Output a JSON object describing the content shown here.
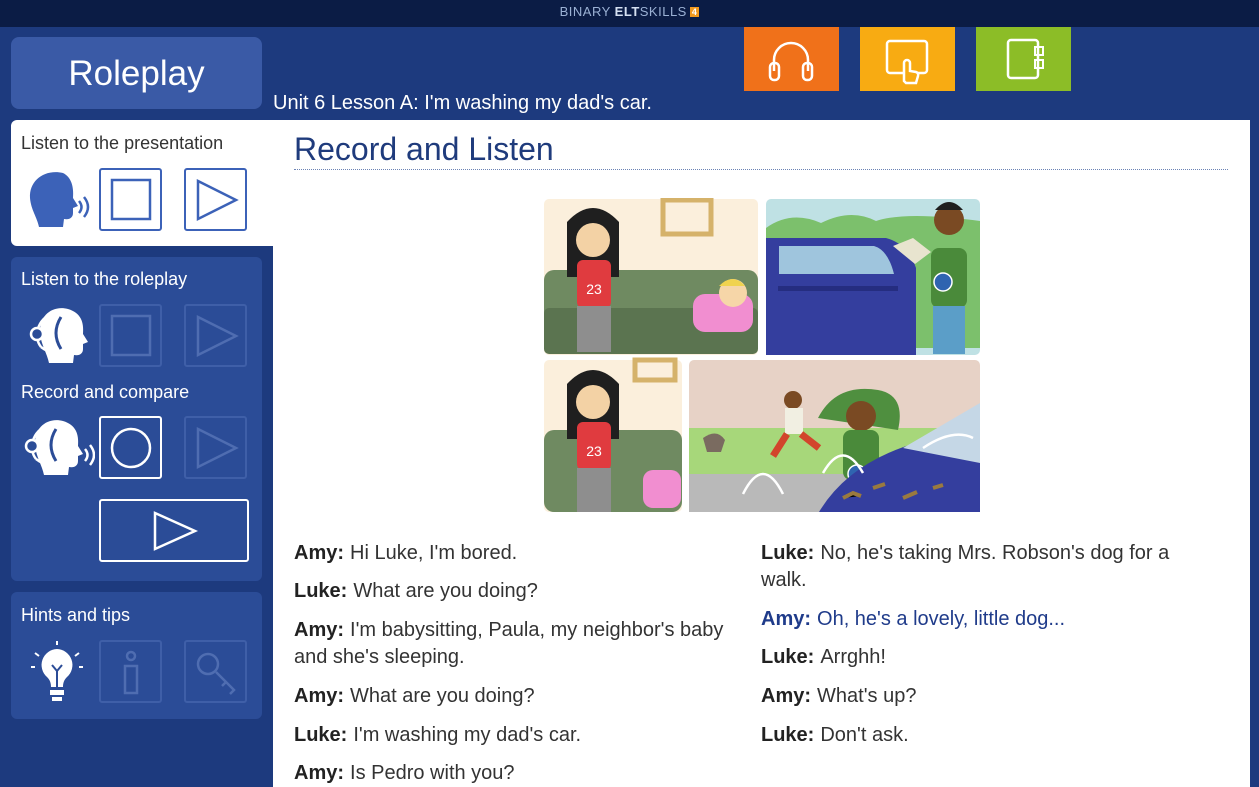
{
  "brand": {
    "part1": "BINARY ",
    "part2": "ELT",
    "part3": "SKILLS",
    "badge": "4"
  },
  "sidebar": {
    "title": "Roleplay",
    "sections": [
      {
        "label": "Listen to the presentation"
      },
      {
        "label": "Listen to the roleplay"
      },
      {
        "label": "Record and compare"
      },
      {
        "label": "Hints and tips"
      }
    ]
  },
  "lesson_title": "Unit 6 Lesson A: I'm washing my dad's car.",
  "top_buttons": [
    {
      "icon": "headphones-icon",
      "color": "#f0711a"
    },
    {
      "icon": "touch-icon",
      "color": "#f8ab12"
    },
    {
      "icon": "notebook-icon",
      "color": "#8cbd27"
    }
  ],
  "content": {
    "title": "Record and Listen",
    "dialogue": [
      {
        "speaker": "Amy:",
        "text": "Hi Luke, I'm bored."
      },
      {
        "speaker": "Luke:",
        "text": "What are you doing?"
      },
      {
        "speaker": "Amy:",
        "text": "I'm babysitting, Paula, my neighbor's baby and she's sleeping."
      },
      {
        "speaker": "Amy:",
        "text": "What are you doing?"
      },
      {
        "speaker": "Luke:",
        "text": "I'm washing my dad's car."
      },
      {
        "speaker": "Amy:",
        "text": "Is Pedro with you?"
      },
      {
        "speaker": "Luke:",
        "text": "No, he's taking Mrs. Robson's dog for a walk."
      },
      {
        "speaker": "Amy:",
        "text": "Oh, he's a lovely, little dog..."
      },
      {
        "speaker": "Luke:",
        "text": "Arrghh!"
      },
      {
        "speaker": "Amy:",
        "text": "What's up?"
      },
      {
        "speaker": "Luke:",
        "text": "Don't ask."
      }
    ]
  },
  "colors": {
    "background": "#1d3a7e",
    "highlight": "#1f3b8a"
  }
}
